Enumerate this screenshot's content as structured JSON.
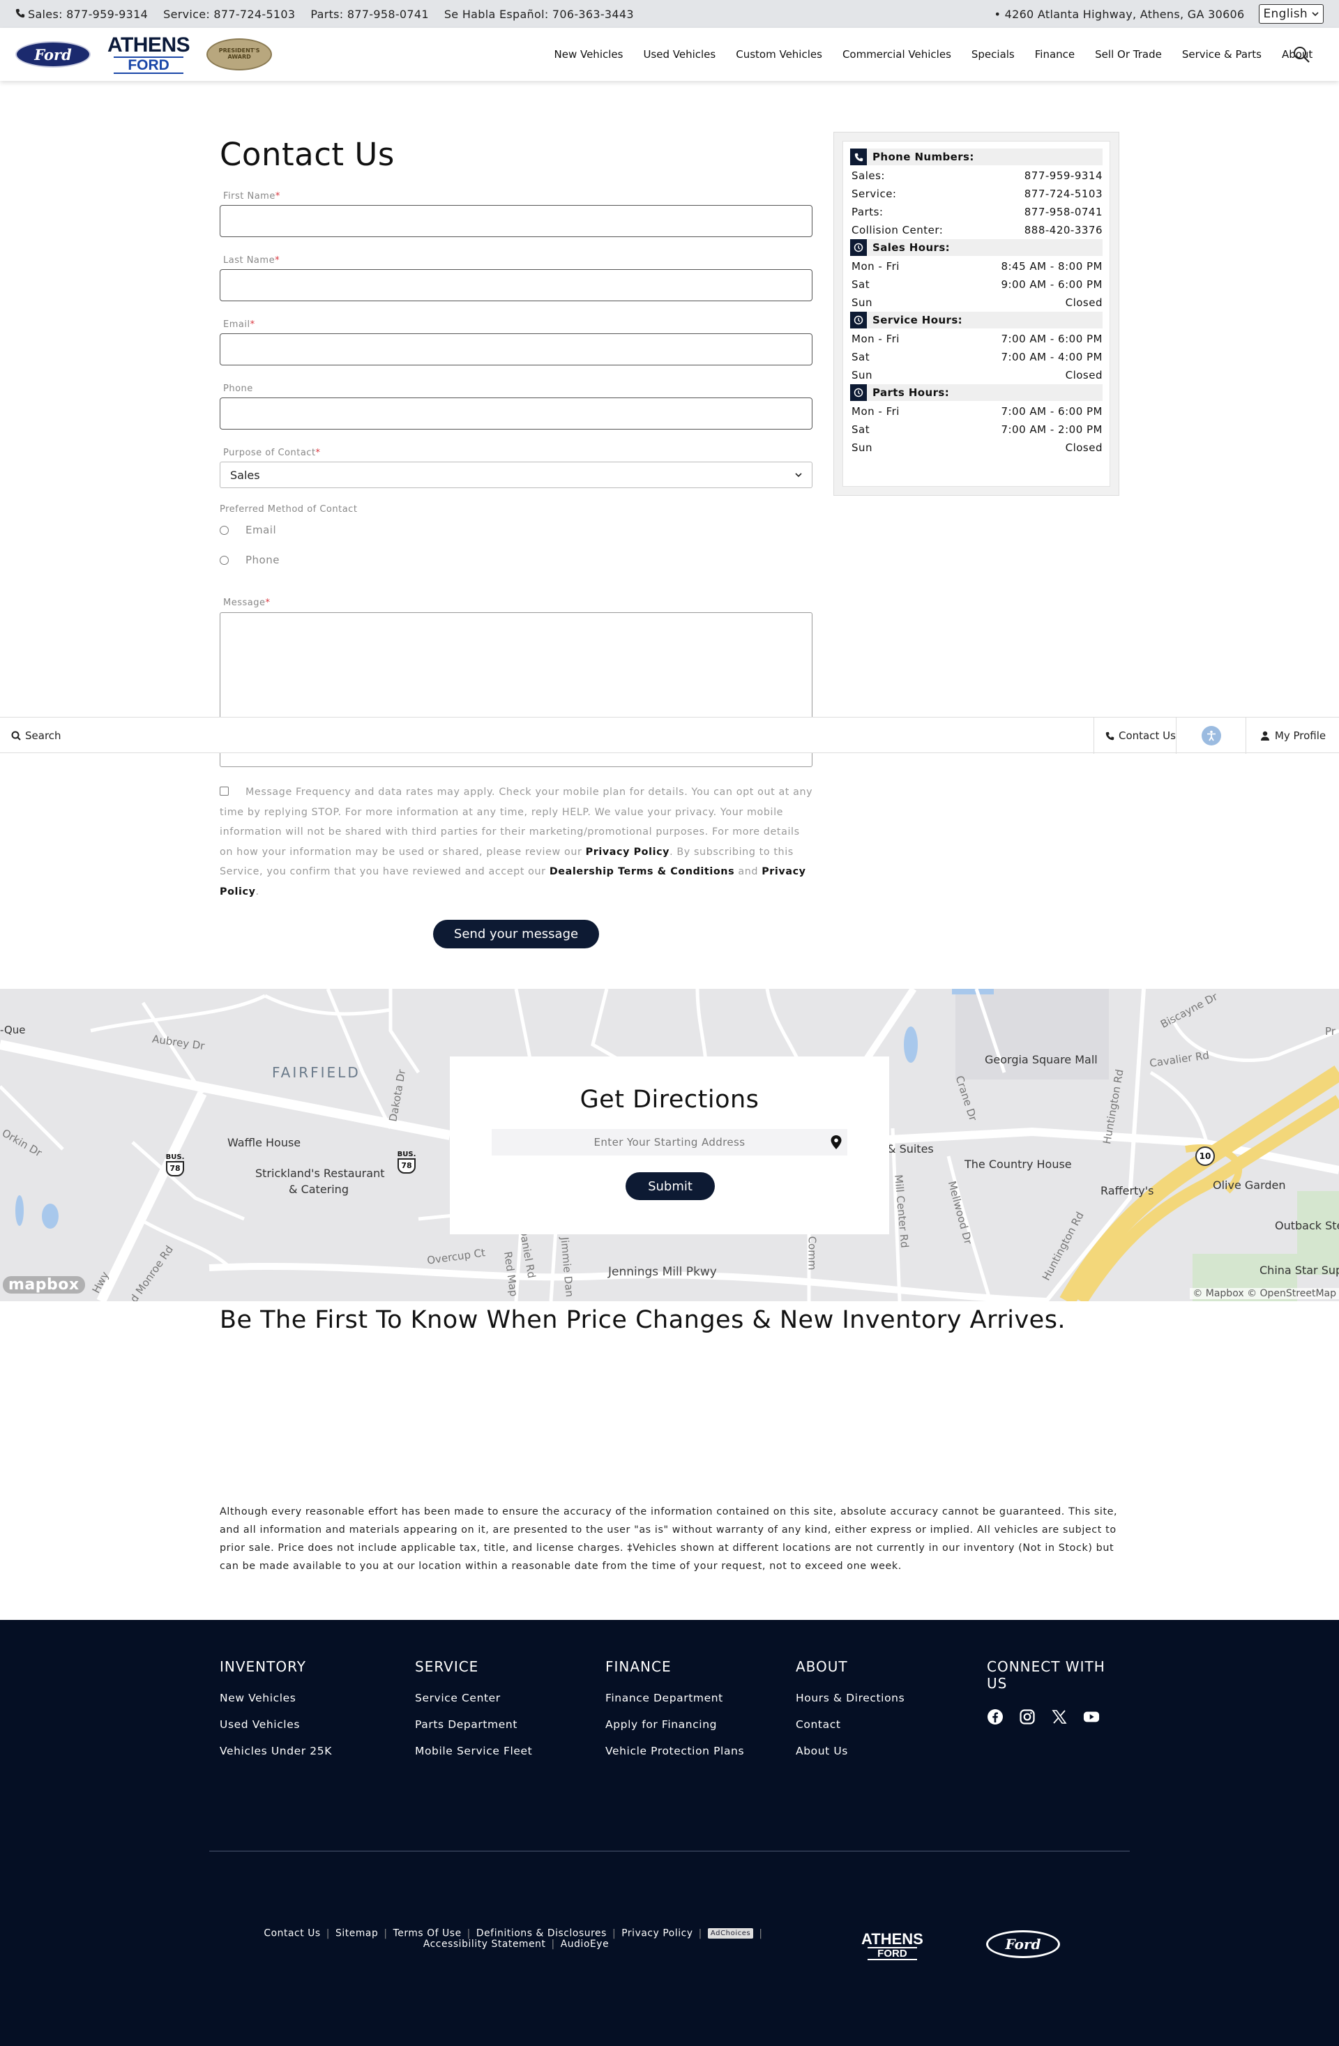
{
  "topbar": {
    "sales": "Sales: 877-959-9314",
    "service": "Service: 877-724-5103",
    "parts": "Parts: 877-958-0741",
    "spanish": "Se Habla Español: 706-363-3443",
    "address": "• 4260 Atlanta Highway, Athens, GA 30606",
    "language": "English"
  },
  "header": {
    "ford_logo": "Ford",
    "athens_logo_line1": "ATHENS",
    "athens_logo_line2": "FORD",
    "award_logo": "PRESIDENT'S AWARD",
    "nav": [
      "New Vehicles",
      "Used Vehicles",
      "Custom Vehicles",
      "Commercial Vehicles",
      "Specials",
      "Finance",
      "Sell Or Trade",
      "Service & Parts",
      "About"
    ]
  },
  "form": {
    "title": "Contact Us",
    "first_name_label": "First Name",
    "last_name_label": "Last Name",
    "email_label": "Email",
    "phone_label": "Phone",
    "purpose_label": "Purpose of Contact",
    "purpose_value": "Sales",
    "preferred_label": "Preferred Method of Contact",
    "pref_email": "Email",
    "pref_phone": "Phone",
    "message_label": "Message",
    "required_mark": "*",
    "consent_text_1": "Message Frequency and data rates may apply. Check your mobile plan for details. You can opt out at any time by replying STOP. For more information at any time, reply HELP. We value your privacy. Your mobile information will not be shared with third parties for their marketing/promotional purposes. For more details on how your information may be used or shared, please review our ",
    "consent_link_1": "Privacy Policy",
    "consent_text_2": ". By subscribing to this Service, you confirm that you have reviewed and accept our ",
    "consent_link_2": "Dealership Terms & Conditions",
    "consent_text_3": " and ",
    "consent_link_3": "Privacy Policy",
    "consent_text_4": ".",
    "submit_label": "Send your message"
  },
  "sticky": {
    "search": "Search",
    "contact": "Contact Us",
    "profile": "My Profile"
  },
  "info": {
    "phone_heading": "Phone Numbers:",
    "phones": [
      {
        "label": "Sales:",
        "value": "877-959-9314"
      },
      {
        "label": "Service:",
        "value": "877-724-5103"
      },
      {
        "label": "Parts:",
        "value": "877-958-0741"
      },
      {
        "label": "Collision Center:",
        "value": "888-420-3376"
      }
    ],
    "sales_heading": "Sales Hours:",
    "sales_hours": [
      {
        "day": "Mon - Fri",
        "time": "8:45 AM - 8:00 PM"
      },
      {
        "day": "Sat",
        "time": "9:00 AM - 6:00 PM"
      },
      {
        "day": "Sun",
        "time": "Closed"
      }
    ],
    "service_heading": "Service Hours:",
    "service_hours": [
      {
        "day": "Mon - Fri",
        "time": "7:00 AM - 6:00 PM"
      },
      {
        "day": "Sat",
        "time": "7:00 AM - 4:00 PM"
      },
      {
        "day": "Sun",
        "time": "Closed"
      }
    ],
    "parts_heading": "Parts Hours:",
    "parts_hours": [
      {
        "day": "Mon - Fri",
        "time": "7:00 AM - 6:00 PM"
      },
      {
        "day": "Sat",
        "time": "7:00 AM - 2:00 PM"
      },
      {
        "day": "Sun",
        "time": "Closed"
      }
    ]
  },
  "map": {
    "labels": {
      "que": "-Que",
      "aubrey": "Aubrey Dr",
      "fairfield": "FAIRFIELD",
      "dakota": "Dakota Dr",
      "orkin": "Orkin Dr",
      "waffle": "Waffle House",
      "stricklands1": "Strickland's Restaurant",
      "stricklands2": "& Catering",
      "bus1": "BUS.",
      "bus1_num": "78",
      "bus2": "BUS.",
      "bus2_num": "78",
      "monroe": "d Monroe Rd",
      "overcup": "Overcup Ct",
      "daniel": "Daniel Rd",
      "redmap": "Red Map",
      "jimmie": "Jimmie Dan",
      "jennings": "Jennings Mill Pkwy",
      "comm": "Comm",
      "biscayne": "Biscayne Dr",
      "cavalier": "Cavalier Rd",
      "georgia": "Georgia Square Mall",
      "crane": "Crane Dr",
      "huntington1": "Huntington Rd",
      "suites": "& Suites",
      "country": "The Country House",
      "raffertys": "Rafferty's",
      "olive": "Olive Garden",
      "outback": "Outback Ste",
      "china": "China Star Sup",
      "millcenter": "Mill Center Rd",
      "mellwood": "Mellwood Dr",
      "huntington2": "Huntington Rd",
      "route10": "10",
      "hwy": "Hwy",
      "pr": "Pr"
    },
    "directions_title": "Get Directions",
    "directions_placeholder": "Enter Your Starting Address",
    "directions_submit": "Submit",
    "mapbox": "mapbox",
    "attribution": "© Mapbox © OpenStreetMap"
  },
  "newsletter_title": "Be The First To Know When Price Changes & New Inventory Arrives.",
  "disclaimer": "Although every reasonable effort has been made to ensure the accuracy of the information contained on this site, absolute accuracy cannot be guaranteed. This site, and all information and materials appearing on it, are presented to the user \"as is\" without warranty of any kind, either express or implied. All vehicles are subject to prior sale. Price does not include applicable tax, title, and license charges. ‡Vehicles shown at different locations are not currently in our inventory (Not in Stock) but can be made available to you at our location within a reasonable date from the time of your request, not to exceed one week.",
  "footer": {
    "inventory": {
      "title": "INVENTORY",
      "links": [
        "New Vehicles",
        "Used Vehicles",
        "Vehicles Under 25K"
      ]
    },
    "service": {
      "title": "SERVICE",
      "links": [
        "Service Center",
        "Parts Department",
        "Mobile Service Fleet"
      ]
    },
    "finance": {
      "title": "FINANCE",
      "links": [
        "Finance Department",
        "Apply for Financing",
        "Vehicle Protection Plans"
      ]
    },
    "about": {
      "title": "ABOUT",
      "links": [
        "Hours & Directions",
        "Contact",
        "About Us"
      ]
    },
    "connect": {
      "title": "CONNECT WITH US"
    },
    "bottom_links": [
      "Contact Us",
      "Sitemap",
      "Terms Of Use",
      "Definitions & Disclosures",
      "Privacy Policy"
    ],
    "adchoices": "AdChoices",
    "bottom_links_2": [
      "Accessibility Statement",
      "AudioEye"
    ],
    "athens_logo_line1": "ATHENS",
    "athens_logo_line2": "FORD",
    "ford_logo": "Ford"
  }
}
